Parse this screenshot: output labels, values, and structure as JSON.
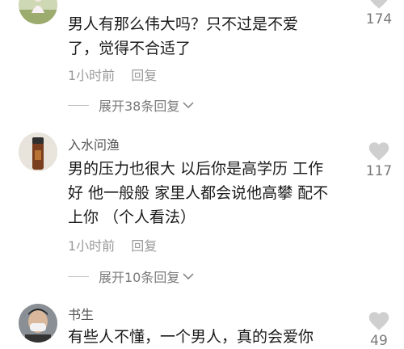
{
  "comments": [
    {
      "username": "",
      "text_lines": [
        "男人有那么伟大吗？只不过是不爱",
        "了，觉得不合适了"
      ],
      "time": "1小时前",
      "reply_label": "回复",
      "likes": "174",
      "expand_label": "展开38条回复"
    },
    {
      "username": "入水问渔",
      "text_lines": [
        "男的压力也很大 以后你是高学历 工作",
        "好 他一般般 家里人都会说他高攀 配不",
        "上你 （个人看法）"
      ],
      "time": "1小时前",
      "reply_label": "回复",
      "likes": "117",
      "expand_label": "展开10条回复"
    },
    {
      "username": "书生",
      "text_lines": [
        "有些人不懂，一个男人，真的会爱你"
      ],
      "likes": "49"
    }
  ],
  "colors": {
    "text": "#1a1a1a",
    "meta": "#9a9a9a",
    "heart": "#cfcfcf"
  },
  "icons": [
    "heart-icon",
    "chevron-down-icon"
  ]
}
